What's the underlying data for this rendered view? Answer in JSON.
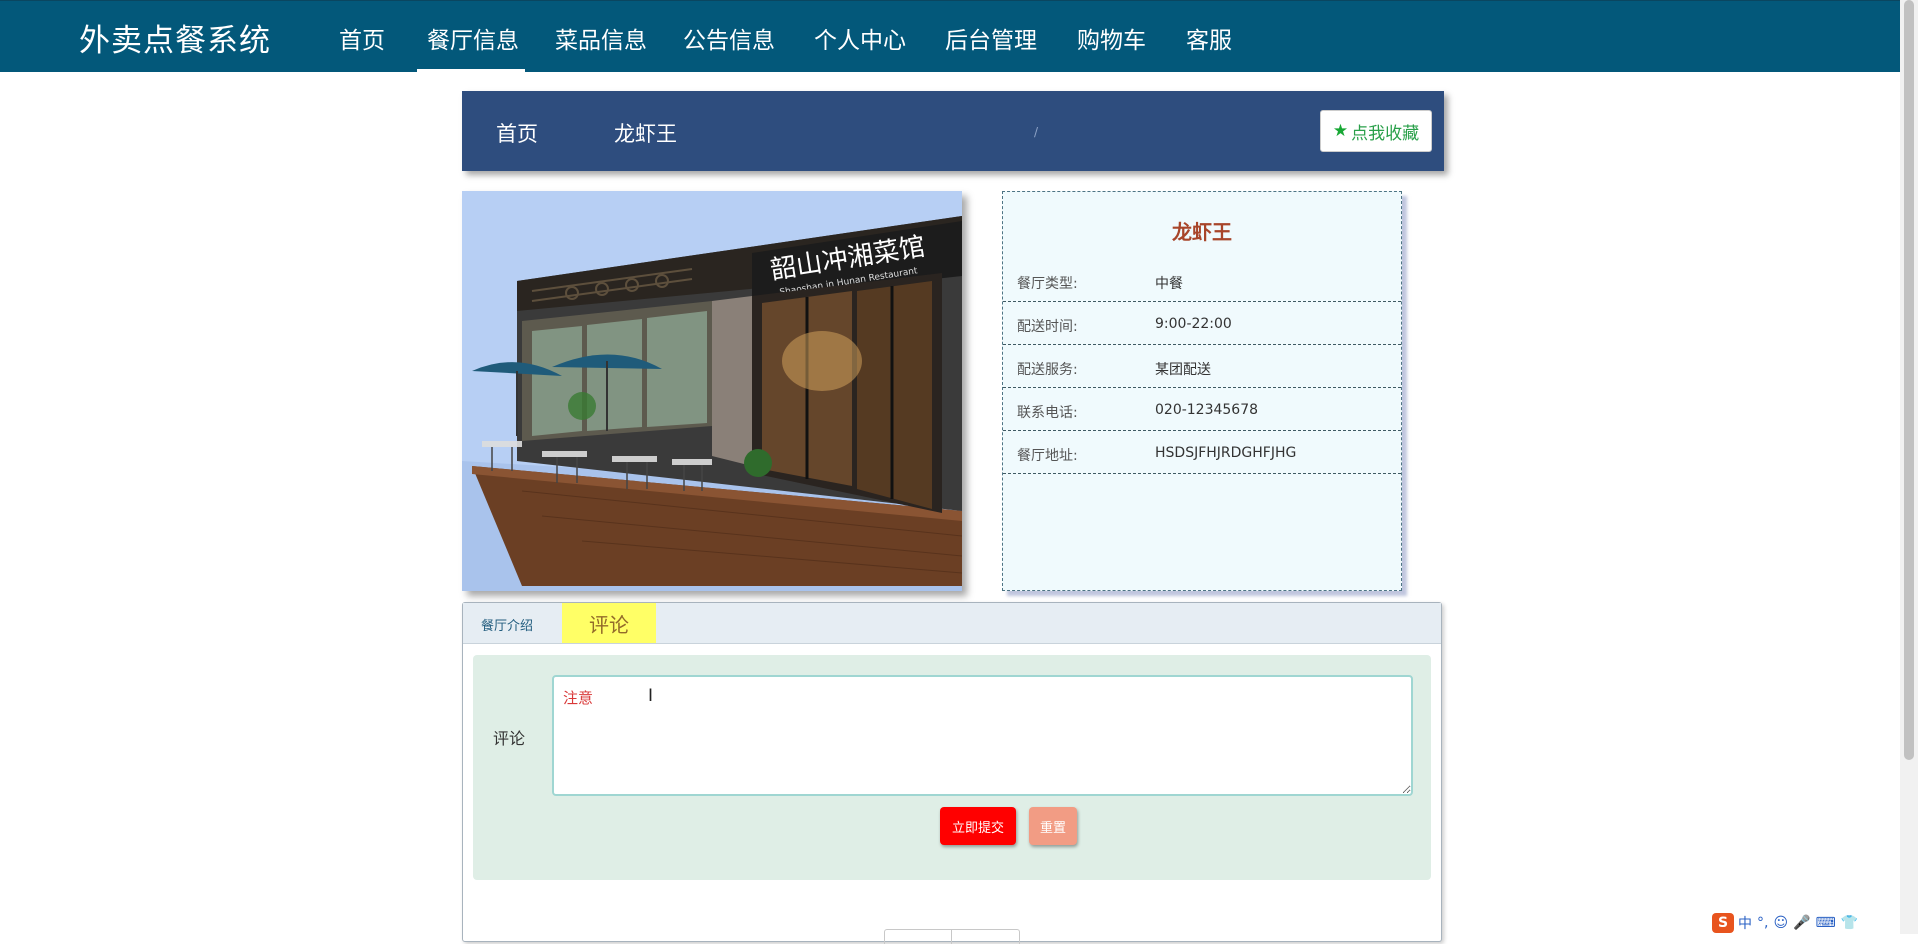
{
  "app": {
    "brand": "外卖点餐系统"
  },
  "nav": {
    "items": [
      {
        "label": "首页"
      },
      {
        "label": "餐厅信息"
      },
      {
        "label": "菜品信息"
      },
      {
        "label": "公告信息"
      },
      {
        "label": "个人中心"
      },
      {
        "label": "后台管理"
      },
      {
        "label": "购物车"
      },
      {
        "label": "客服"
      }
    ],
    "active": "餐厅信息"
  },
  "breadcrumb": {
    "home": "首页",
    "separator": "/",
    "current": "龙虾王"
  },
  "favorite": {
    "label": "点我收藏",
    "icon": "star-icon"
  },
  "photo": {
    "sign_text": "韶山冲湘菜馆",
    "sign_subtext": "Shaoshan in Hunan Restaurant"
  },
  "restaurant": {
    "name": "龙虾王",
    "fields": [
      {
        "label": "餐厅类型:",
        "value": "中餐"
      },
      {
        "label": "配送时间:",
        "value": "9:00-22:00"
      },
      {
        "label": "配送服务:",
        "value": "某团配送"
      },
      {
        "label": "联系电话:",
        "value": "020-12345678"
      },
      {
        "label": "餐厅地址:",
        "value": "HSDSJFHJRDGHFJHG"
      }
    ]
  },
  "tabs": {
    "items": [
      {
        "label": "餐厅介绍"
      },
      {
        "label": "评论"
      }
    ],
    "active": "评论"
  },
  "comment_form": {
    "label": "评论",
    "value": "注意",
    "submit_label": "立即提交",
    "reset_label": "重置"
  },
  "ime": {
    "items": [
      "中",
      "°,",
      "☺",
      "🎤",
      "⌨",
      "👕"
    ]
  },
  "colors": {
    "topnav_bg": "#03587a",
    "crumb_bg": "#2e4d7e",
    "title_color": "#a8452a",
    "submit_bg": "#ff0000",
    "reset_bg": "#f29c84",
    "tab_highlight": "#ffff66"
  }
}
